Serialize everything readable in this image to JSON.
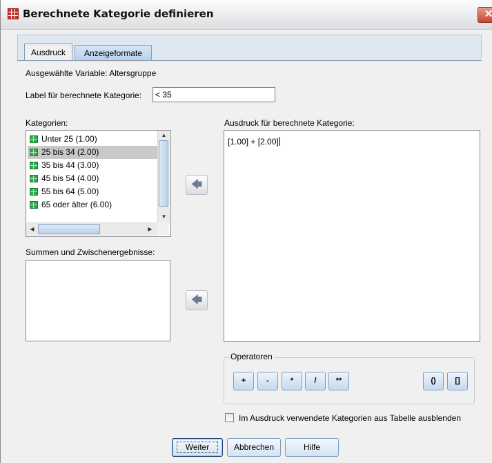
{
  "window": {
    "title": "Berechnete Kategorie definieren",
    "close_glyph": "✕"
  },
  "tabs": [
    {
      "label": "Ausdruck",
      "active": true
    },
    {
      "label": "Anzeigeformate",
      "active": false
    }
  ],
  "selected_variable": {
    "label": "Ausgewählte Variable:",
    "value": "Altersgruppe"
  },
  "label_field": {
    "label": "Label für berechnete Kategorie:",
    "value": "< 35"
  },
  "categories": {
    "label": "Kategorien:",
    "items": [
      {
        "label": "Unter 25 (1.00)",
        "selected": false
      },
      {
        "label": "25 bis 34 (2.00)",
        "selected": true
      },
      {
        "label": "35 bis 44 (3.00)",
        "selected": false
      },
      {
        "label": "45 bis 54 (4.00)",
        "selected": false
      },
      {
        "label": "55 bis 64 (5.00)",
        "selected": false
      },
      {
        "label": "65 oder älter (6.00)",
        "selected": false
      }
    ],
    "icon": "category-grid-icon"
  },
  "subtotals": {
    "label": "Summen und Zwischenergebnisse:"
  },
  "expression": {
    "label": "Ausdruck für berechnete Kategorie:",
    "value": "[1.00] + [2.00]"
  },
  "move_buttons": {
    "icon": "arrow-left-icon",
    "glyph": "🡄"
  },
  "operators": {
    "label": "Operatoren",
    "buttons": [
      "+",
      "-",
      "*",
      "/",
      "**",
      "()",
      "[]"
    ]
  },
  "hide_checkbox": {
    "label": "Im Ausdruck verwendete Kategorien aus Tabelle ausblenden",
    "checked": false
  },
  "footer": {
    "continue": "Weiter",
    "cancel": "Abbrechen",
    "help": "Hilfe"
  },
  "colors": {
    "title_icon": "#c9302c",
    "category_icon": "#2fa84f",
    "selection": "#c9c9c9"
  }
}
